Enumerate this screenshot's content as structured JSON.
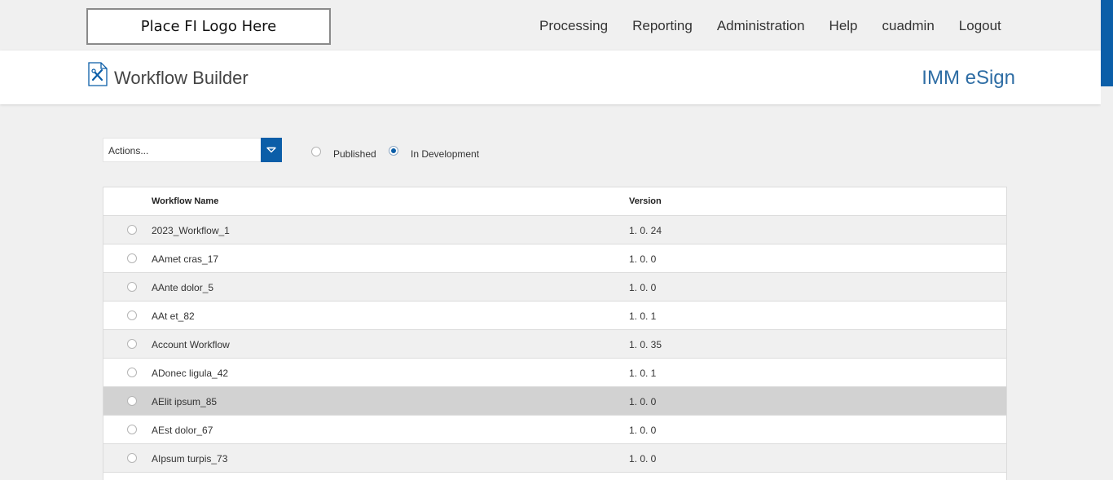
{
  "header": {
    "logo_text": "Place FI Logo Here",
    "nav": [
      "Processing",
      "Reporting",
      "Administration",
      "Help",
      "cuadmin",
      "Logout"
    ],
    "page_title": "Workflow Builder",
    "page_icon": "workflow-tools-icon",
    "product_name": "IMM eSign"
  },
  "toolbar": {
    "actions_placeholder": "Actions...",
    "filter_published": "Published",
    "filter_in_development": "In Development",
    "selected_filter": "In Development"
  },
  "table": {
    "columns": [
      "Workflow Name",
      "Version"
    ],
    "rows": [
      {
        "name": "2023_Workflow_1",
        "version": "1. 0. 24"
      },
      {
        "name": "AAmet cras_17",
        "version": "1. 0. 0"
      },
      {
        "name": "AAnte dolor_5",
        "version": "1. 0. 0"
      },
      {
        "name": "AAt et_82",
        "version": "1. 0. 1"
      },
      {
        "name": "Account Workflow",
        "version": "1. 0. 35"
      },
      {
        "name": "ADonec ligula_42",
        "version": "1. 0. 1"
      },
      {
        "name": "AElit ipsum_85",
        "version": "1. 0. 0"
      },
      {
        "name": "AEst dolor_67",
        "version": "1. 0. 0"
      },
      {
        "name": "AIpsum turpis_73",
        "version": "1. 0. 0"
      }
    ]
  },
  "colors": {
    "accent": "#0b5ea8",
    "product": "#2e6da4",
    "row_alt": "#f0f0f0",
    "row_hover": "#d2d2d2"
  }
}
